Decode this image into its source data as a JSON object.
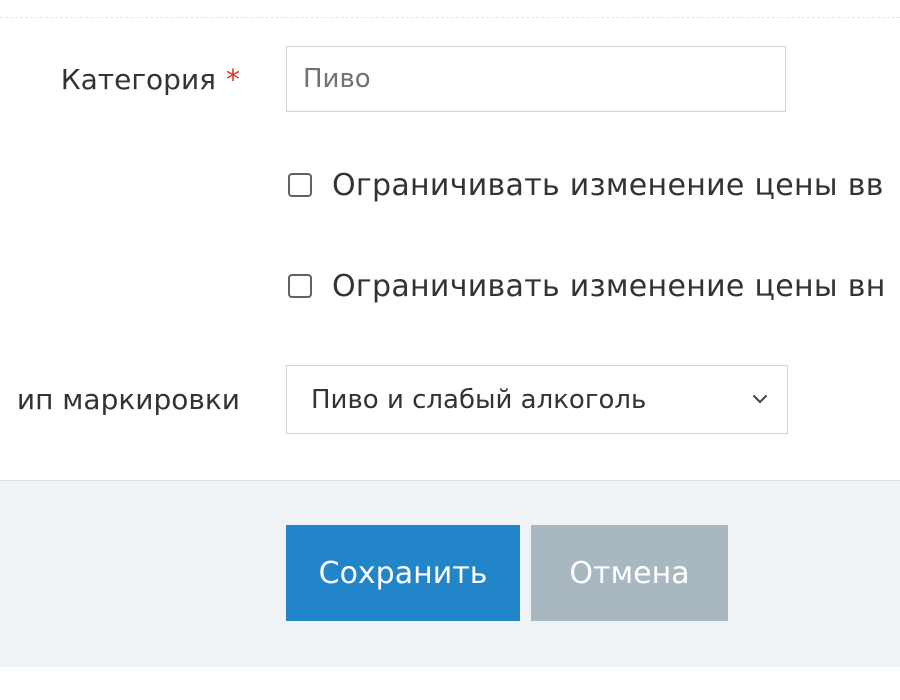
{
  "form": {
    "category": {
      "label": "Категория",
      "required_mark": "*",
      "value": "Пиво"
    },
    "checkboxes": [
      {
        "label": "Ограничивать изменение цены вв",
        "checked": false
      },
      {
        "label": "Ограничивать изменение цены вн",
        "checked": false
      }
    ],
    "marking_type": {
      "label": "ип маркировки",
      "selected": "Пиво и слабый алкоголь"
    }
  },
  "footer": {
    "save_label": "Сохранить",
    "cancel_label": "Отмена"
  },
  "colors": {
    "primary_button": "#2285c9",
    "secondary_button": "#a9b7c1",
    "required": "#e0302d",
    "footer_background": "#f0f3f5"
  }
}
